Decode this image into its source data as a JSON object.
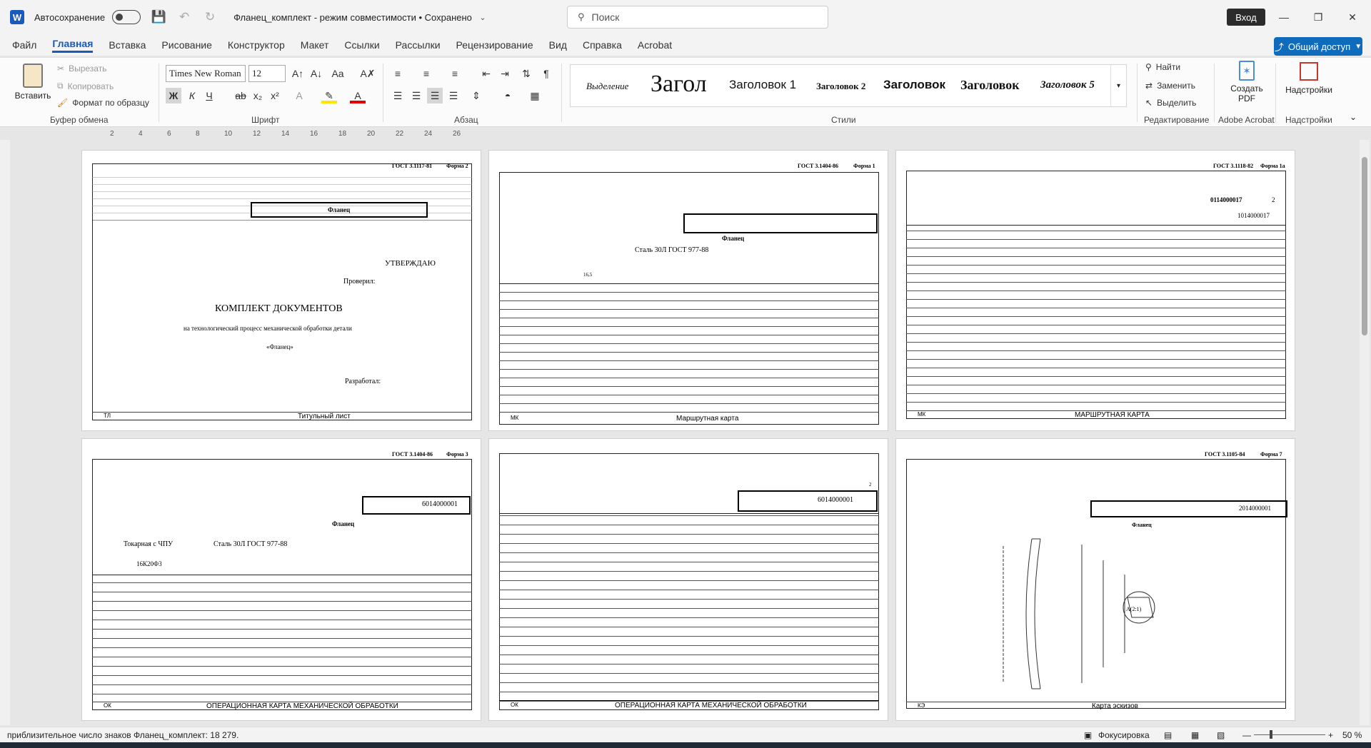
{
  "window": {
    "autosave_label": "Автосохранение",
    "title": "Фланец_комплект  -  режим совместимости • Сохранено",
    "search_placeholder": "Поиск",
    "login_label": "Вход"
  },
  "menu": {
    "tabs": [
      "Файл",
      "Главная",
      "Вставка",
      "Рисование",
      "Конструктор",
      "Макет",
      "Ссылки",
      "Рассылки",
      "Рецензирование",
      "Вид",
      "Справка",
      "Acrobat"
    ],
    "active": "Главная",
    "share_label": "Общий доступ"
  },
  "ribbon": {
    "clipboard": {
      "paste": "Вставить",
      "cut": "Вырезать",
      "copy": "Копировать",
      "format_painter": "Формат по образцу",
      "label": "Буфер обмена"
    },
    "font": {
      "name": "Times New Roman",
      "size": "12",
      "label": "Шрифт",
      "bold": "Ж",
      "italic": "К",
      "underline": "Ч"
    },
    "paragraph": {
      "label": "Абзац"
    },
    "styles": {
      "label": "Стили",
      "items": [
        "Выделение",
        "Загол",
        "Заголовок 1",
        "Заголовок 2",
        "Заголовок 3",
        "Заголовок",
        "Заголовок 5"
      ]
    },
    "editing": {
      "find": "Найти",
      "replace": "Заменить",
      "select": "Выделить",
      "label": "Редактирование"
    },
    "acrobat": {
      "create_pdf": "Создать PDF",
      "label": "Adobe Acrobat"
    },
    "addins": {
      "label": "Надстройки",
      "button": "Надстройки"
    }
  },
  "ruler": {
    "ticks": [
      "2",
      "4",
      "6",
      "8",
      "10",
      "12",
      "14",
      "16",
      "18",
      "20",
      "22",
      "24",
      "26"
    ]
  },
  "pages": [
    {
      "gost": "ГОСТ 3.1117-81",
      "form": "Форма 2",
      "part": "Фланец",
      "approve": "УТВЕРЖДАЮ",
      "checked": "Проверил:",
      "heading": "КОМПЛЕКТ ДОКУМЕНТОВ",
      "subheading": "на технологический процесс механической обработки детали",
      "detail": "«Фланец»",
      "developed": "Разработал:",
      "code": "ТЛ",
      "footer": "Титульный лист"
    },
    {
      "gost": "ГОСТ 3.1404-86",
      "form": "Форма 1",
      "part": "Фланец",
      "material": "Сталь 30Л ГОСТ 977-88",
      "mass": "16,5",
      "code": "МК",
      "footer": "Маршрутная карта"
    },
    {
      "gost": "ГОСТ 3.1118-82",
      "form": "Форма 1а",
      "doc_no": "0114000017",
      "doc_no2": "1014000017",
      "sheet": "2",
      "code": "МК",
      "footer": "МАРШРУТНАЯ КАРТА"
    },
    {
      "gost": "ГОСТ 3.1404-86",
      "form": "Форма 3",
      "doc_no": "6014000001",
      "part": "Фланец",
      "operation": "Токарная с ЧПУ",
      "material": "Сталь 30Л ГОСТ 977-88",
      "machine": "16К20Ф3",
      "code": "ОК",
      "footer": "ОПЕРАЦИОННАЯ КАРТА МЕХАНИЧЕСКОЙ ОБРАБОТКИ"
    },
    {
      "gost": "",
      "form": "",
      "doc_no": "6014000001",
      "sheet": "2",
      "code": "ОК",
      "footer": "ОПЕРАЦИОННАЯ КАРТА МЕХАНИЧЕСКОЙ ОБРАБОТКИ"
    },
    {
      "gost": "ГОСТ 3.1105-84",
      "form": "Форма 7",
      "doc_no": "2014000001",
      "part": "Фланец",
      "detail_label": "А(2:1)",
      "code": "КЭ",
      "footer": "Карта эскизов"
    }
  ],
  "status": {
    "word_count": "приблизительное число знаков Фланец_комплект: 18 279.",
    "focus": "Фокусировка",
    "zoom": "50 %"
  }
}
